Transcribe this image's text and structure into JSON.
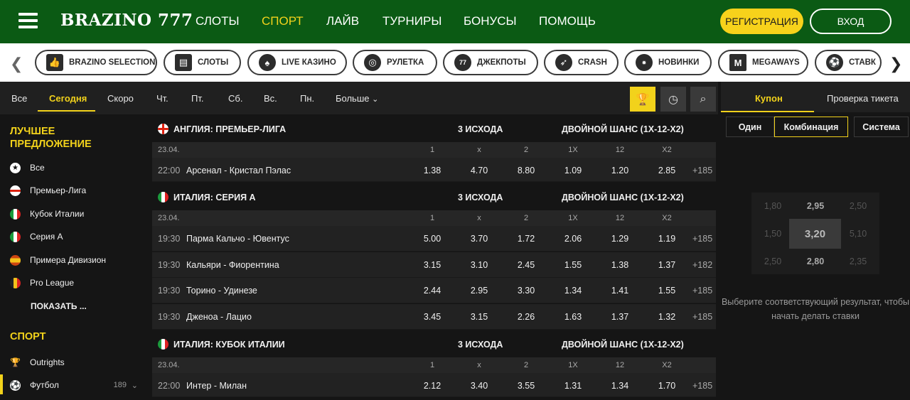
{
  "header": {
    "logo": "BRAZINO 777",
    "nav": [
      "СЛОТЫ",
      "СПОРТ",
      "ЛАЙВ",
      "ТУРНИРЫ",
      "БОНУСЫ",
      "ПОМОЩЬ"
    ],
    "active_nav": "СПОРТ",
    "register_label": "РЕГИСТРАЦИЯ",
    "login_label": "ВХОД"
  },
  "categories": [
    {
      "label": "BRAZINO SELECTION",
      "icon": "thumbs-up-icon"
    },
    {
      "label": "СЛОТЫ",
      "icon": "slot-machine-icon"
    },
    {
      "label": "LIVE КАЗИНО",
      "icon": "live-casino-icon"
    },
    {
      "label": "РУЛЕТКА",
      "icon": "roulette-icon"
    },
    {
      "label": "ДЖЕКПОТЫ",
      "icon": "jackpot-777-icon"
    },
    {
      "label": "CRASH",
      "icon": "rocket-icon"
    },
    {
      "label": "НОВИНКИ",
      "icon": "new-badge-icon"
    },
    {
      "label": "MEGAWAYS",
      "icon": "megaways-icon"
    },
    {
      "label": "СТАВК",
      "icon": "soccer-ball-icon"
    }
  ],
  "subtabs": [
    "Все",
    "Сегодня",
    "Скоро",
    "Чт.",
    "Пт.",
    "Сб.",
    "Вс.",
    "Пн.",
    "Больше"
  ],
  "active_subtab": "Сегодня",
  "sidebar": {
    "best_title_line1": "ЛУЧШЕЕ",
    "best_title_line2": "ПРЕДЛОЖЕНИЕ",
    "best_items": [
      "Все",
      "Премьер-Лига",
      "Кубок Италии",
      "Серия А",
      "Примера Дивизион",
      "Pro League",
      "ПОКАЗАТЬ ..."
    ],
    "sport_title": "СПОРТ",
    "sport_items": [
      {
        "label": "Outrights",
        "count": ""
      },
      {
        "label": "Футбол",
        "count": "189"
      }
    ]
  },
  "markets": {
    "three_way": "3 ИСХОДА",
    "double_chance": "ДВОЙНОЙ ШАНС (1Х-12-Х2)",
    "headers": [
      "1",
      "x",
      "2",
      "1X",
      "12",
      "X2"
    ]
  },
  "leagues": [
    {
      "name": "АНГЛИЯ: ПРЕМЬЕР-ЛИГА",
      "flag": "england",
      "date": "23.04.",
      "matches": [
        {
          "time": "22:00",
          "teams": "Арсенал - Кристал Пэлас",
          "odds": [
            "1.38",
            "4.70",
            "8.80",
            "1.09",
            "1.20",
            "2.85"
          ],
          "more": "+185"
        }
      ]
    },
    {
      "name": "ИТАЛИЯ: СЕРИЯ А",
      "flag": "italy",
      "date": "23.04.",
      "matches": [
        {
          "time": "19:30",
          "teams": "Парма Кальчо - Ювентус",
          "odds": [
            "5.00",
            "3.70",
            "1.72",
            "2.06",
            "1.29",
            "1.19"
          ],
          "more": "+185"
        },
        {
          "time": "19:30",
          "teams": "Кальяри - Фиорентина",
          "odds": [
            "3.15",
            "3.10",
            "2.45",
            "1.55",
            "1.38",
            "1.37"
          ],
          "more": "+182"
        },
        {
          "time": "19:30",
          "teams": "Торино - Удинезе",
          "odds": [
            "2.44",
            "2.95",
            "3.30",
            "1.34",
            "1.41",
            "1.55"
          ],
          "more": "+185"
        },
        {
          "time": "19:30",
          "teams": "Дженоа - Лацио",
          "odds": [
            "3.45",
            "3.15",
            "2.26",
            "1.63",
            "1.37",
            "1.32"
          ],
          "more": "+185"
        }
      ]
    },
    {
      "name": "ИТАЛИЯ: КУБОК ИТАЛИИ",
      "flag": "italy",
      "date": "23.04.",
      "matches": [
        {
          "time": "22:00",
          "teams": "Интер - Милан",
          "odds": [
            "2.12",
            "3.40",
            "3.55",
            "1.31",
            "1.34",
            "1.70"
          ],
          "more": "+185"
        }
      ]
    }
  ],
  "coupon": {
    "tabs": [
      "Купон",
      "Проверка тикета"
    ],
    "types": [
      "Один",
      "Комбинация",
      "Система"
    ],
    "active_type": "Комбинация",
    "grid": [
      "1,80",
      "2,95",
      "2,50",
      "1,50",
      "3,20",
      "5,10",
      "2,50",
      "2,80",
      "2,35"
    ],
    "message": "Выберите соответствующий результат, чтобы начать делать ставки"
  },
  "colors": {
    "header_bg": "#0b5a14",
    "accent": "#f2d21b",
    "panel": "#222222"
  }
}
